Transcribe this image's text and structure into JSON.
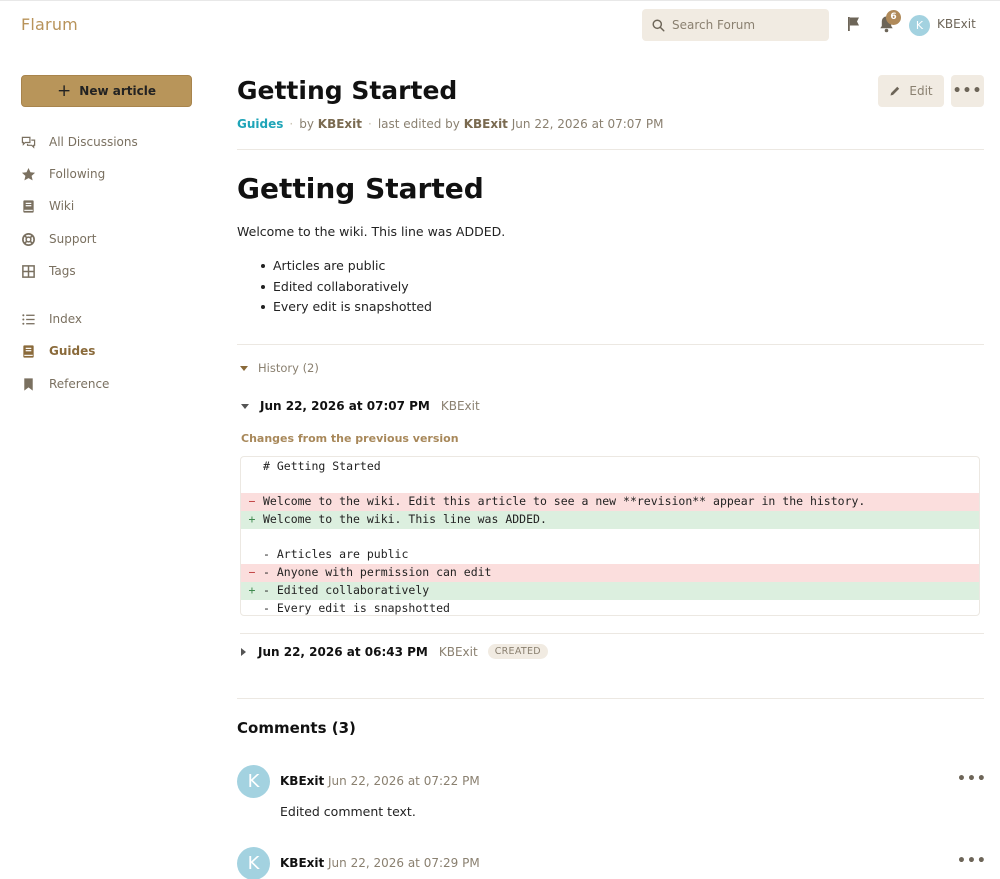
{
  "header": {
    "brand": "Flarum",
    "search_placeholder": "Search Forum",
    "notification_count": "6",
    "user_initial": "K",
    "username": "KBExit"
  },
  "sidebar": {
    "new_article_label": "New article",
    "items": [
      {
        "label": "All Discussions",
        "icon": "discussions-icon"
      },
      {
        "label": "Following",
        "icon": "star-icon"
      },
      {
        "label": "Wiki",
        "icon": "book-icon"
      },
      {
        "label": "Support",
        "icon": "lifebuoy-icon"
      },
      {
        "label": "Tags",
        "icon": "grid-icon"
      },
      {
        "label": "Index",
        "icon": "list-icon"
      },
      {
        "label": "Guides",
        "icon": "book-icon",
        "active": true
      },
      {
        "label": "Reference",
        "icon": "bookmark-icon"
      }
    ]
  },
  "article": {
    "title": "Getting Started",
    "edit_label": "Edit",
    "more_label": "•••",
    "meta": {
      "tag": "Guides",
      "by_prefix": "by",
      "author": "KBExit",
      "edited_prefix": "last edited by",
      "editor": "KBExit",
      "edited_time": "Jun 22, 2026 at 07:07 PM"
    },
    "heading": "Getting Started",
    "paragraph": "Welcome to the wiki. This line was ADDED.",
    "list": [
      "Articles are public",
      "Edited collaboratively",
      "Every edit is snapshotted"
    ]
  },
  "history": {
    "toggle_label": "History (2)",
    "revisions": [
      {
        "date": "Jun 22, 2026 at 07:07 PM",
        "user": "KBExit",
        "expanded": true
      },
      {
        "date": "Jun 22, 2026 at 06:43 PM",
        "user": "KBExit",
        "badge": "CREATED",
        "expanded": false
      }
    ],
    "changes_label": "Changes from the previous version",
    "diff": [
      {
        "type": "ctx",
        "sign": " ",
        "text": "# Getting Started"
      },
      {
        "type": "ctx",
        "sign": " ",
        "text": ""
      },
      {
        "type": "del",
        "sign": "−",
        "text": "Welcome to the wiki. Edit this article to see a new **revision** appear in the history."
      },
      {
        "type": "add",
        "sign": "+",
        "text": "Welcome to the wiki. This line was ADDED."
      },
      {
        "type": "ctx",
        "sign": " ",
        "text": ""
      },
      {
        "type": "ctx",
        "sign": " ",
        "text": "- Articles are public"
      },
      {
        "type": "del",
        "sign": "−",
        "text": "- Anyone with permission can edit"
      },
      {
        "type": "add",
        "sign": "+",
        "text": "- Edited collaboratively"
      },
      {
        "type": "ctx",
        "sign": " ",
        "text": "- Every edit is snapshotted"
      }
    ]
  },
  "comments": {
    "title": "Comments (3)",
    "items": [
      {
        "initial": "K",
        "user": "KBExit",
        "time": "Jun 22, 2026 at 07:22 PM",
        "body": "Edited comment text.",
        "more": "•••"
      },
      {
        "initial": "K",
        "user": "KBExit",
        "time": "Jun 22, 2026 at 07:29 PM",
        "body": "",
        "more": "•••"
      }
    ]
  },
  "colors": {
    "accent": "#b8955a",
    "tag": "#1fa5b8",
    "diff_del": "#fbdedd",
    "diff_add": "#dcefdf",
    "avatar": "#a3d2e0"
  }
}
